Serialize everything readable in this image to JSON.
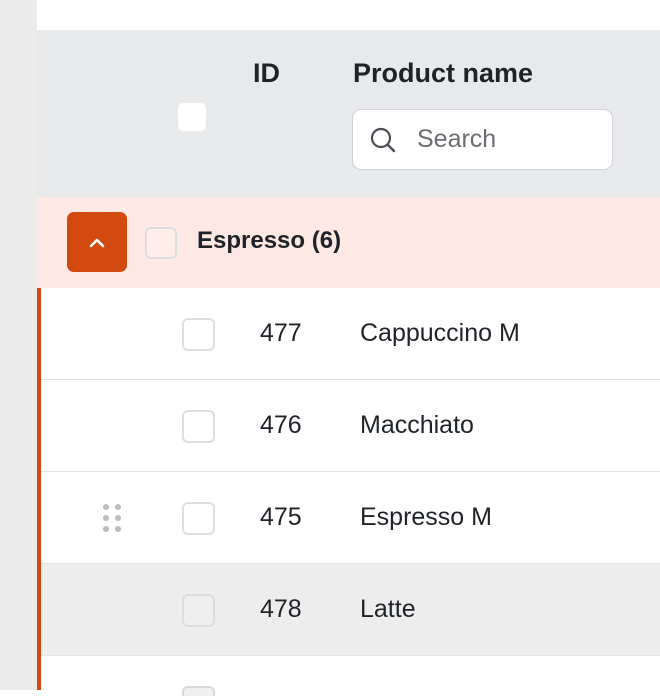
{
  "table": {
    "columns": {
      "id": "ID",
      "product_name": "Product name"
    },
    "search": {
      "placeholder": "Search",
      "value": ""
    },
    "group": {
      "label": "Espresso (6)",
      "expanded": true,
      "icon": "chevron-up-icon",
      "accent_color": "#d24a0f"
    },
    "rows": [
      {
        "id": "477",
        "name": "Cappuccino M"
      },
      {
        "id": "476",
        "name": "Macchiato"
      },
      {
        "id": "475",
        "name": "Espresso M",
        "drag_handle": true
      },
      {
        "id": "478",
        "name": "Latte",
        "hovered": true
      }
    ]
  }
}
